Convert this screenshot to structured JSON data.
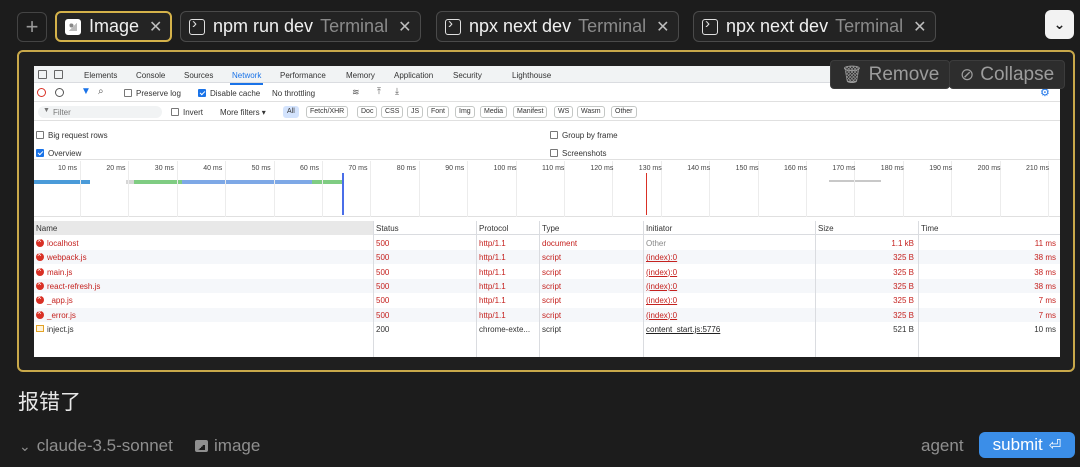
{
  "tabs": [
    {
      "name": "Image",
      "kind": "",
      "icon": "image-icon",
      "active": true
    },
    {
      "name": "npm run dev",
      "kind": "Terminal",
      "icon": "terminal-icon",
      "active": false
    },
    {
      "name": "npx next dev",
      "kind": "Terminal",
      "icon": "terminal-icon",
      "active": false
    },
    {
      "name": "npx next dev",
      "kind": "Terminal",
      "icon": "terminal-icon",
      "active": false
    }
  ],
  "top": {
    "plus": "+",
    "close": "✕",
    "chevron": "⌄"
  },
  "panel": {
    "remove_label": "Remove",
    "collapse_label": "Collapse",
    "accent": "#c8a84a"
  },
  "devtools": {
    "tabs": [
      "Elements",
      "Console",
      "Sources",
      "Network",
      "Performance",
      "Memory",
      "Application",
      "Security",
      "Lighthouse"
    ],
    "active_tab": "Network",
    "toolbar": {
      "preserve_log": "Preserve log",
      "disable_cache": "Disable cache",
      "throttling": "No throttling"
    },
    "filter": {
      "placeholder": "Filter",
      "invert": "Invert",
      "more_filters": "More filters ▾"
    },
    "types": [
      "All",
      "Fetch/XHR",
      "Doc",
      "CSS",
      "JS",
      "Font",
      "Img",
      "Media",
      "Manifest",
      "WS",
      "Wasm",
      "Other"
    ],
    "options": {
      "big_request_rows": "Big request rows",
      "overview": "Overview",
      "group_by_frame": "Group by frame",
      "screenshots": "Screenshots"
    },
    "timeline_ticks": [
      "10 ms",
      "20 ms",
      "30 ms",
      "40 ms",
      "50 ms",
      "60 ms",
      "70 ms",
      "80 ms",
      "90 ms",
      "100 ms",
      "110 ms",
      "120 ms",
      "130 ms",
      "140 ms",
      "150 ms",
      "160 ms",
      "170 ms",
      "180 ms",
      "190 ms",
      "200 ms",
      "210 ms"
    ],
    "columns": [
      "Name",
      "Status",
      "Protocol",
      "Type",
      "Initiator",
      "Size",
      "Time"
    ],
    "rows": [
      {
        "name": "localhost",
        "status": "500",
        "protocol": "http/1.1",
        "type": "document",
        "initiator": "Other",
        "size": "1.1 kB",
        "time": "11 ms",
        "error": true
      },
      {
        "name": "webpack.js",
        "status": "500",
        "protocol": "http/1.1",
        "type": "script",
        "initiator": "(index):0",
        "size": "325 B",
        "time": "38 ms",
        "error": true
      },
      {
        "name": "main.js",
        "status": "500",
        "protocol": "http/1.1",
        "type": "script",
        "initiator": "(index):0",
        "size": "325 B",
        "time": "38 ms",
        "error": true
      },
      {
        "name": "react-refresh.js",
        "status": "500",
        "protocol": "http/1.1",
        "type": "script",
        "initiator": "(index):0",
        "size": "325 B",
        "time": "38 ms",
        "error": true
      },
      {
        "name": "_app.js",
        "status": "500",
        "protocol": "http/1.1",
        "type": "script",
        "initiator": "(index):0",
        "size": "325 B",
        "time": "7 ms",
        "error": true
      },
      {
        "name": "_error.js",
        "status": "500",
        "protocol": "http/1.1",
        "type": "script",
        "initiator": "(index):0",
        "size": "325 B",
        "time": "7 ms",
        "error": true
      },
      {
        "name": "inject.js",
        "status": "200",
        "protocol": "chrome-exte...",
        "type": "script",
        "initiator": "content_start.js:5776",
        "size": "521 B",
        "time": "10 ms",
        "error": false
      }
    ]
  },
  "message": "报错了",
  "bottom": {
    "model": "claude-3.5-sonnet",
    "image_label": "image",
    "mode": "agent",
    "submit_label": "submit",
    "submit_color": "#3b8ee8"
  }
}
